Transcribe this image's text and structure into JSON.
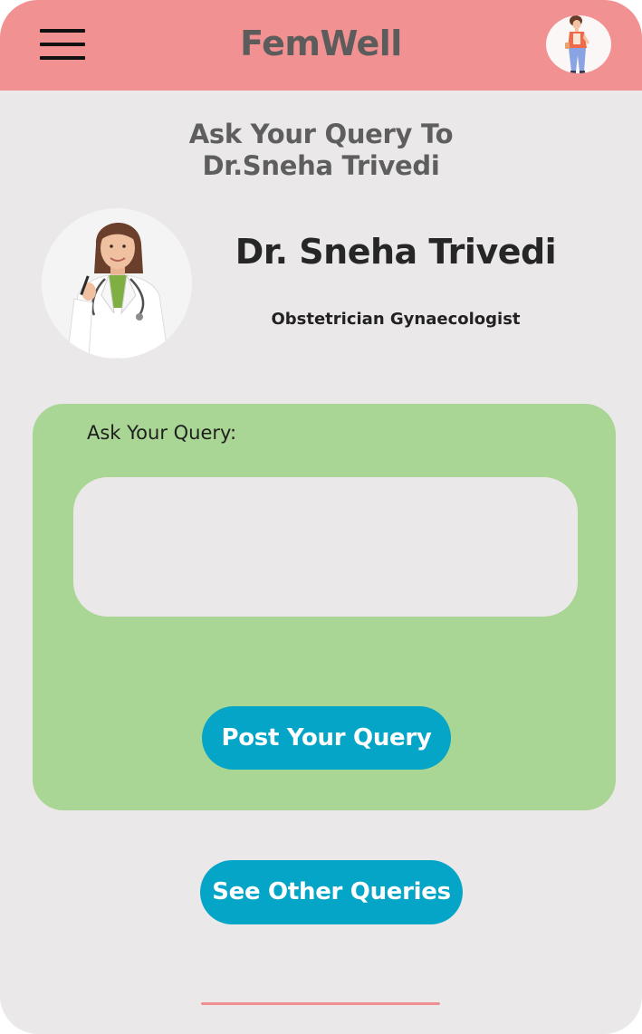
{
  "header": {
    "app_title": "FemWell",
    "menu_icon": "hamburger-menu-icon",
    "avatar_icon": "user-avatar-icon"
  },
  "page": {
    "heading_line1": "Ask Your Query To",
    "heading_line2": "Dr.Sneha Trivedi"
  },
  "doctor": {
    "name": "Dr. Sneha Trivedi",
    "specialization": "Obstetrician Gynaecologist",
    "photo_icon": "doctor-portrait"
  },
  "query_form": {
    "label": "Ask Your Query:",
    "input_value": "",
    "input_placeholder": "",
    "submit_label": "Post Your Query"
  },
  "actions": {
    "see_other_label": "See Other Queries"
  },
  "colors": {
    "header_bg": "#f19192",
    "page_bg": "#ebe8e9",
    "card_bg": "#a9d694",
    "button_bg": "#05a5c7",
    "home_indicator": "#ef8f93"
  }
}
